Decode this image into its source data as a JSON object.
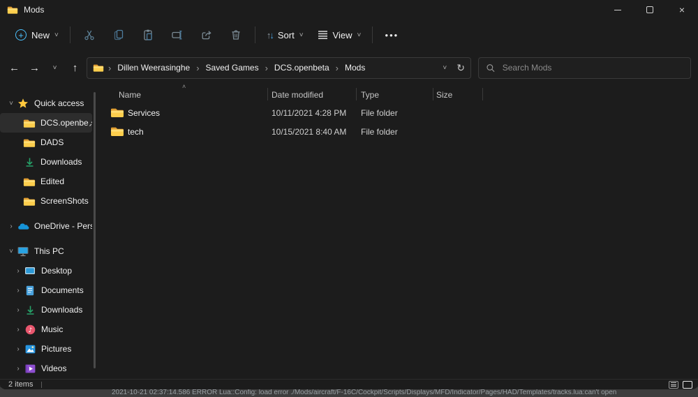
{
  "titlebar": {
    "title": "Mods"
  },
  "toolbar": {
    "new_label": "New",
    "sort_label": "Sort",
    "view_label": "View"
  },
  "navbar": {
    "breadcrumbs": [
      "Dillen Weerasinghe",
      "Saved Games",
      "DCS.openbeta",
      "Mods"
    ],
    "search_placeholder": "Search Mods"
  },
  "sidebar": {
    "quick_access": {
      "label": "Quick access",
      "items": [
        {
          "label": "DCS.openbe",
          "icon": "folder",
          "pinned": true,
          "selected": true
        },
        {
          "label": "DADS",
          "icon": "folder"
        },
        {
          "label": "Downloads",
          "icon": "download-arrow"
        },
        {
          "label": "Edited",
          "icon": "folder"
        },
        {
          "label": "ScreenShots",
          "icon": "folder"
        }
      ]
    },
    "onedrive": {
      "label": "OneDrive - Perso",
      "icon": "cloud"
    },
    "this_pc": {
      "label": "This PC",
      "icon": "monitor",
      "items": [
        {
          "label": "Desktop",
          "icon": "desktop"
        },
        {
          "label": "Documents",
          "icon": "document"
        },
        {
          "label": "Downloads",
          "icon": "download-arrow"
        },
        {
          "label": "Music",
          "icon": "music-note"
        },
        {
          "label": "Pictures",
          "icon": "picture"
        },
        {
          "label": "Videos",
          "icon": "video"
        }
      ]
    }
  },
  "filelist": {
    "columns": [
      "Name",
      "Date modified",
      "Type",
      "Size"
    ],
    "sorted_column": "Name",
    "sort_direction": "ascending",
    "rows": [
      {
        "name": "Services",
        "date_modified": "10/11/2021 4:28 PM",
        "type": "File folder",
        "size": ""
      },
      {
        "name": "tech",
        "date_modified": "10/15/2021 8:40 AM",
        "type": "File folder",
        "size": ""
      }
    ]
  },
  "statusbar": {
    "items_count": "2 items"
  },
  "background_window": {
    "log_line": "2021-10-21 02:37:14.586 ERROR   Lua::Config: load error ./Mods/aircraft/F-16C/Cockpit/Scripts/Displays/MFD/Indicator/Pages/HAD/Templates/tracks.lua:can't open"
  },
  "icons": {
    "titlebar": "folder-icon",
    "toolbar": [
      "plus-circle-icon",
      "scissors-cut-icon",
      "copy-icon",
      "paste-clipboard-icon",
      "rename-icon",
      "share-icon",
      "trash-delete-icon",
      "sort-arrows-icon",
      "view-lines-icon",
      "ellipsis-more-icon"
    ],
    "navigation": [
      "back-arrow-icon",
      "forward-arrow-icon",
      "recent-chevron-icon",
      "up-arrow-icon",
      "breadcrumb-chevron-icon",
      "refresh-icon",
      "search-magnifier-icon"
    ],
    "sidebar": [
      "star-icon",
      "folder-icon",
      "pin-icon",
      "download-arrow-icon",
      "cloud-icon",
      "monitor-icon",
      "desktop-icon",
      "document-icon",
      "music-icon",
      "pictures-icon",
      "videos-icon"
    ],
    "statusbar": [
      "details-view-icon",
      "large-icons-view-icon"
    ]
  },
  "colors": {
    "accent": "#4cc2ff",
    "folder_body": "#fdce4d",
    "folder_tab": "#e19f33",
    "selection_bg": "#2d2d2d",
    "window_bg": "#1c1c1c",
    "download_green": "#26a269",
    "onedrive_blue": "#1694d8",
    "videos_purple": "#8f4fd1"
  }
}
